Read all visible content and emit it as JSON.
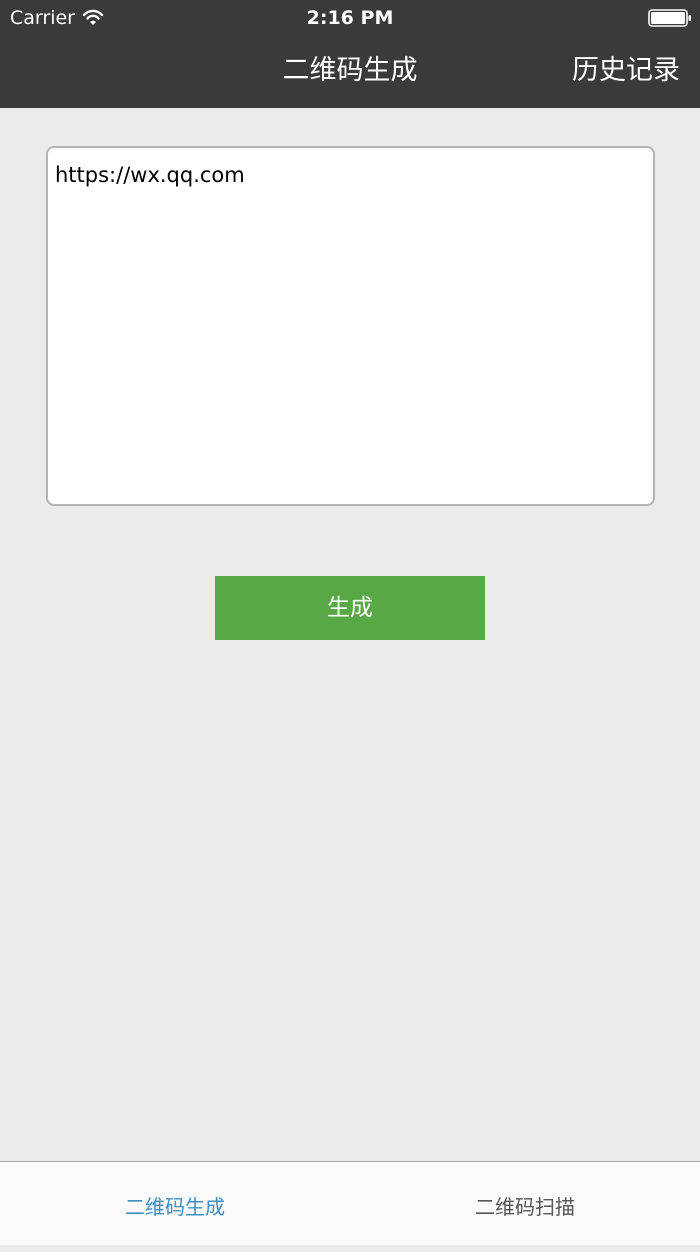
{
  "status_bar": {
    "carrier": "Carrier",
    "time": "2:16 PM",
    "icons": [
      "wifi-icon",
      "battery-icon"
    ]
  },
  "nav": {
    "title": "二维码生成",
    "history_label": "历史记录"
  },
  "input": {
    "value": "https://wx.qq.com"
  },
  "generate_button": {
    "label": "生成"
  },
  "tabs": [
    {
      "label": "二维码生成",
      "selected": true
    },
    {
      "label": "二维码扫描",
      "selected": false
    }
  ],
  "colors": {
    "nav_background": "#3a3a3a",
    "page_background": "#ebebeb",
    "button_green": "#58a846",
    "tab_selected": "#3e8ec4",
    "tab_unselected": "#555555"
  }
}
